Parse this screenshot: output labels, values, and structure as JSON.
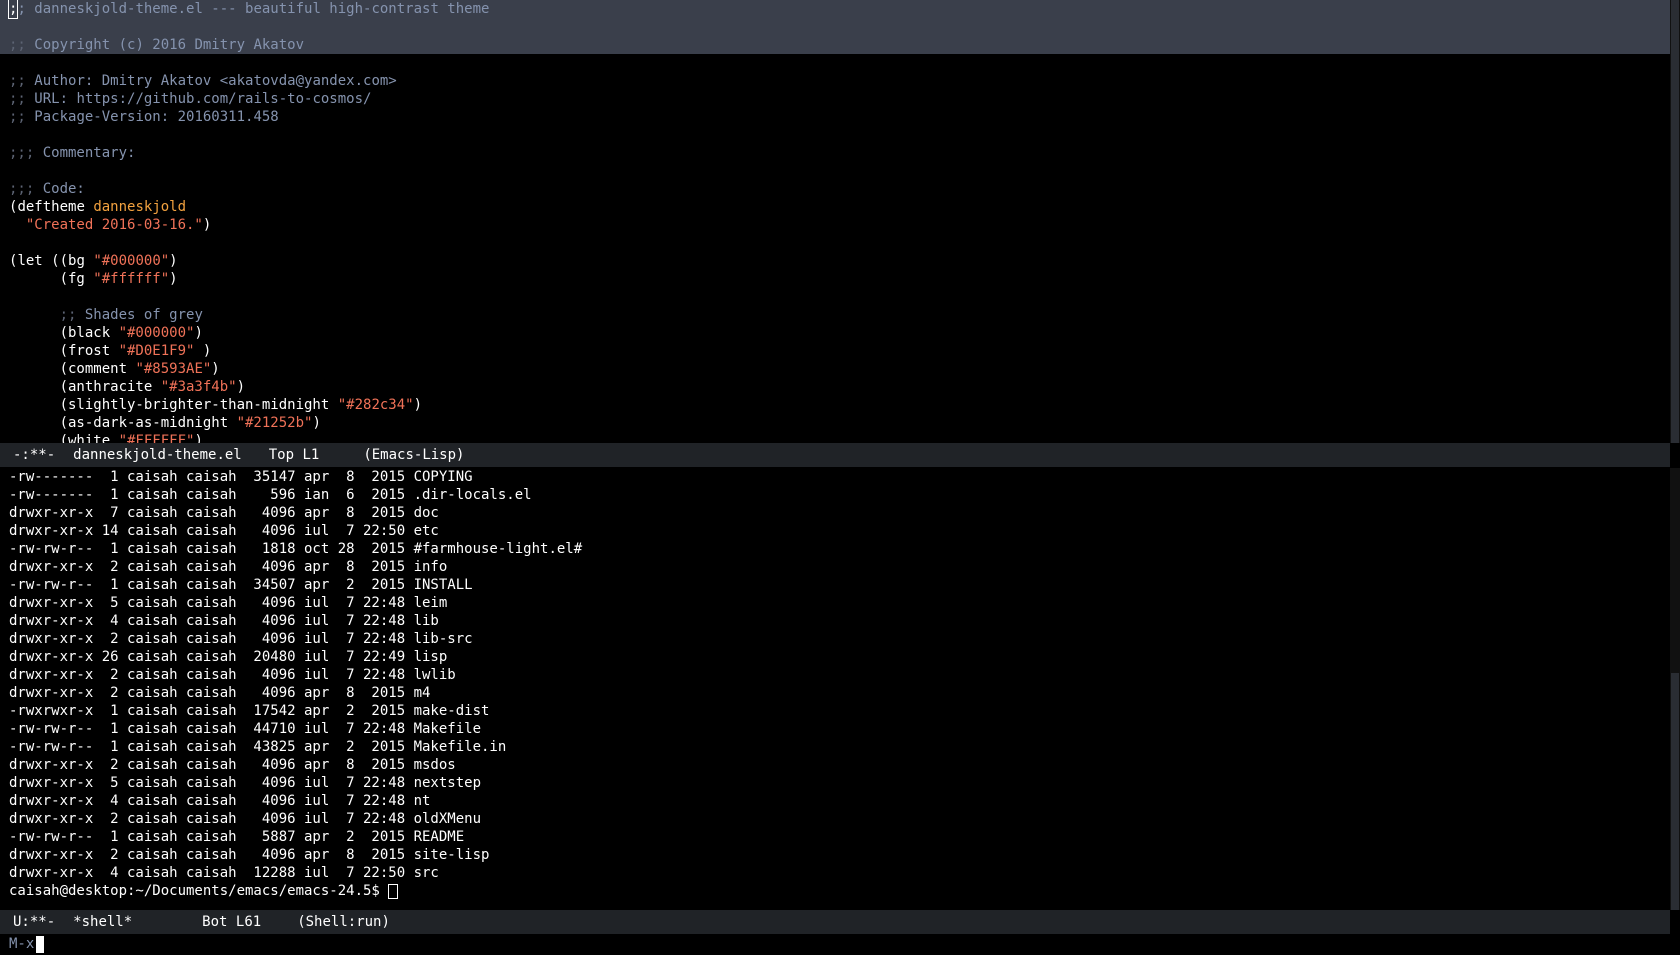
{
  "editor": {
    "lines": [
      {
        "segments": [
          {
            "text": ";",
            "cls": "cursor-block"
          },
          {
            "text": "; danneskjold-theme.el --- beautiful high-contrast theme",
            "cls": "c-comment"
          }
        ],
        "highlight": true
      },
      {
        "segments": [
          {
            "text": "",
            "cls": "c-fg"
          }
        ],
        "highlight": true
      },
      {
        "segments": [
          {
            "text": ";; ",
            "cls": "c-dim"
          },
          {
            "text": "Copyright (c) 2016 Dmitry Akatov",
            "cls": "c-comment"
          }
        ],
        "highlight": true
      },
      {
        "segments": [
          {
            "text": "",
            "cls": "c-fg"
          }
        ],
        "highlight": false
      },
      {
        "segments": [
          {
            "text": ";; ",
            "cls": "c-dim"
          },
          {
            "text": "Author: Dmitry Akatov <akatovda@yandex.com>",
            "cls": "c-comment"
          }
        ],
        "highlight": false
      },
      {
        "segments": [
          {
            "text": ";; ",
            "cls": "c-dim"
          },
          {
            "text": "URL: https://github.com/rails-to-cosmos/",
            "cls": "c-comment"
          }
        ],
        "highlight": false
      },
      {
        "segments": [
          {
            "text": ";; ",
            "cls": "c-dim"
          },
          {
            "text": "Package-Version: 20160311.458",
            "cls": "c-comment"
          }
        ],
        "highlight": false
      },
      {
        "segments": [
          {
            "text": "",
            "cls": "c-fg"
          }
        ],
        "highlight": false
      },
      {
        "segments": [
          {
            "text": ";;; ",
            "cls": "c-dim"
          },
          {
            "text": "Commentary:",
            "cls": "c-comment"
          }
        ],
        "highlight": false
      },
      {
        "segments": [
          {
            "text": "",
            "cls": "c-fg"
          }
        ],
        "highlight": false
      },
      {
        "segments": [
          {
            "text": ";;; ",
            "cls": "c-dim"
          },
          {
            "text": "Code:",
            "cls": "c-comment"
          }
        ],
        "highlight": false
      },
      {
        "segments": [
          {
            "text": "(",
            "cls": "c-fg"
          },
          {
            "text": "deftheme",
            "cls": "c-kw"
          },
          {
            "text": " ",
            "cls": "c-fg"
          },
          {
            "text": "danneskjold",
            "cls": "c-name"
          }
        ],
        "highlight": false
      },
      {
        "segments": [
          {
            "text": "  ",
            "cls": "c-fg"
          },
          {
            "text": "\"Created 2016-03-16.\"",
            "cls": "c-str"
          },
          {
            "text": ")",
            "cls": "c-fg"
          }
        ],
        "highlight": false
      },
      {
        "segments": [
          {
            "text": "",
            "cls": "c-fg"
          }
        ],
        "highlight": false
      },
      {
        "segments": [
          {
            "text": "(",
            "cls": "c-fg"
          },
          {
            "text": "let",
            "cls": "c-kw"
          },
          {
            "text": " ((bg ",
            "cls": "c-fg"
          },
          {
            "text": "\"#000000\"",
            "cls": "c-str"
          },
          {
            "text": ")",
            "cls": "c-fg"
          }
        ],
        "highlight": false
      },
      {
        "segments": [
          {
            "text": "      (fg ",
            "cls": "c-fg"
          },
          {
            "text": "\"#ffffff\"",
            "cls": "c-str"
          },
          {
            "text": ")",
            "cls": "c-fg"
          }
        ],
        "highlight": false
      },
      {
        "segments": [
          {
            "text": "",
            "cls": "c-fg"
          }
        ],
        "highlight": false
      },
      {
        "segments": [
          {
            "text": "      ",
            "cls": "c-fg"
          },
          {
            "text": ";; ",
            "cls": "c-dim"
          },
          {
            "text": "Shades of grey",
            "cls": "c-comment"
          }
        ],
        "highlight": false
      },
      {
        "segments": [
          {
            "text": "      (black ",
            "cls": "c-fg"
          },
          {
            "text": "\"#000000\"",
            "cls": "c-str"
          },
          {
            "text": ")",
            "cls": "c-fg"
          }
        ],
        "highlight": false
      },
      {
        "segments": [
          {
            "text": "      (frost ",
            "cls": "c-fg"
          },
          {
            "text": "\"#D0E1F9\"",
            "cls": "c-str"
          },
          {
            "text": " )",
            "cls": "c-fg"
          }
        ],
        "highlight": false
      },
      {
        "segments": [
          {
            "text": "      (comment ",
            "cls": "c-fg"
          },
          {
            "text": "\"#8593AE\"",
            "cls": "c-str"
          },
          {
            "text": ")",
            "cls": "c-fg"
          }
        ],
        "highlight": false
      },
      {
        "segments": [
          {
            "text": "      (anthracite ",
            "cls": "c-fg"
          },
          {
            "text": "\"#3a3f4b\"",
            "cls": "c-str"
          },
          {
            "text": ")",
            "cls": "c-fg"
          }
        ],
        "highlight": false
      },
      {
        "segments": [
          {
            "text": "      (slightly-brighter-than-midnight ",
            "cls": "c-fg"
          },
          {
            "text": "\"#282c34\"",
            "cls": "c-str"
          },
          {
            "text": ")",
            "cls": "c-fg"
          }
        ],
        "highlight": false
      },
      {
        "segments": [
          {
            "text": "      (as-dark-as-midnight ",
            "cls": "c-fg"
          },
          {
            "text": "\"#21252b\"",
            "cls": "c-str"
          },
          {
            "text": ")",
            "cls": "c-fg"
          }
        ],
        "highlight": false
      },
      {
        "segments": [
          {
            "text": "      (white ",
            "cls": "c-fg"
          },
          {
            "text": "\"#FFFFFF\"",
            "cls": "c-str"
          },
          {
            "text": ")",
            "cls": "c-fg"
          }
        ],
        "highlight": false
      }
    ]
  },
  "modeline_editor": {
    "status": "-:**-",
    "buffer": "danneskjold-theme.el",
    "position": "Top L1",
    "mode": "(Emacs-Lisp)"
  },
  "shell": {
    "lines": [
      "-rw-------  1 caisah caisah  35147 apr  8  2015 COPYING",
      "-rw-------  1 caisah caisah    596 ian  6  2015 .dir-locals.el",
      "drwxr-xr-x  7 caisah caisah   4096 apr  8  2015 doc",
      "drwxr-xr-x 14 caisah caisah   4096 iul  7 22:50 etc",
      "-rw-rw-r--  1 caisah caisah   1818 oct 28  2015 #farmhouse-light.el#",
      "drwxr-xr-x  2 caisah caisah   4096 apr  8  2015 info",
      "-rw-rw-r--  1 caisah caisah  34507 apr  2  2015 INSTALL",
      "drwxr-xr-x  5 caisah caisah   4096 iul  7 22:48 leim",
      "drwxr-xr-x  4 caisah caisah   4096 iul  7 22:48 lib",
      "drwxr-xr-x  2 caisah caisah   4096 iul  7 22:48 lib-src",
      "drwxr-xr-x 26 caisah caisah  20480 iul  7 22:49 lisp",
      "drwxr-xr-x  2 caisah caisah   4096 iul  7 22:48 lwlib",
      "drwxr-xr-x  2 caisah caisah   4096 apr  8  2015 m4",
      "-rwxrwxr-x  1 caisah caisah  17542 apr  2  2015 make-dist",
      "-rw-rw-r--  1 caisah caisah  44710 iul  7 22:48 Makefile",
      "-rw-rw-r--  1 caisah caisah  43825 apr  2  2015 Makefile.in",
      "drwxr-xr-x  2 caisah caisah   4096 apr  8  2015 msdos",
      "drwxr-xr-x  5 caisah caisah   4096 iul  7 22:48 nextstep",
      "drwxr-xr-x  4 caisah caisah   4096 iul  7 22:48 nt",
      "drwxr-xr-x  2 caisah caisah   4096 iul  7 22:48 oldXMenu",
      "-rw-rw-r--  1 caisah caisah   5887 apr  2  2015 README",
      "drwxr-xr-x  2 caisah caisah   4096 apr  8  2015 site-lisp",
      "drwxr-xr-x  4 caisah caisah  12288 iul  7 22:50 src"
    ],
    "prompt": "caisah@desktop:~/Documents/emacs/emacs-24.5$ "
  },
  "modeline_shell": {
    "status": "U:**-",
    "buffer": "*shell*",
    "position": "Bot L61",
    "mode": "(Shell:run)"
  },
  "minibuffer": {
    "prompt": "M-x"
  },
  "colors": {
    "background": "#000000",
    "foreground": "#ffffff",
    "comment": "#8593AE",
    "string": "#f07258",
    "name": "#f3a23f",
    "region_highlight": "#3a3f4b",
    "modeline": "#202327"
  }
}
